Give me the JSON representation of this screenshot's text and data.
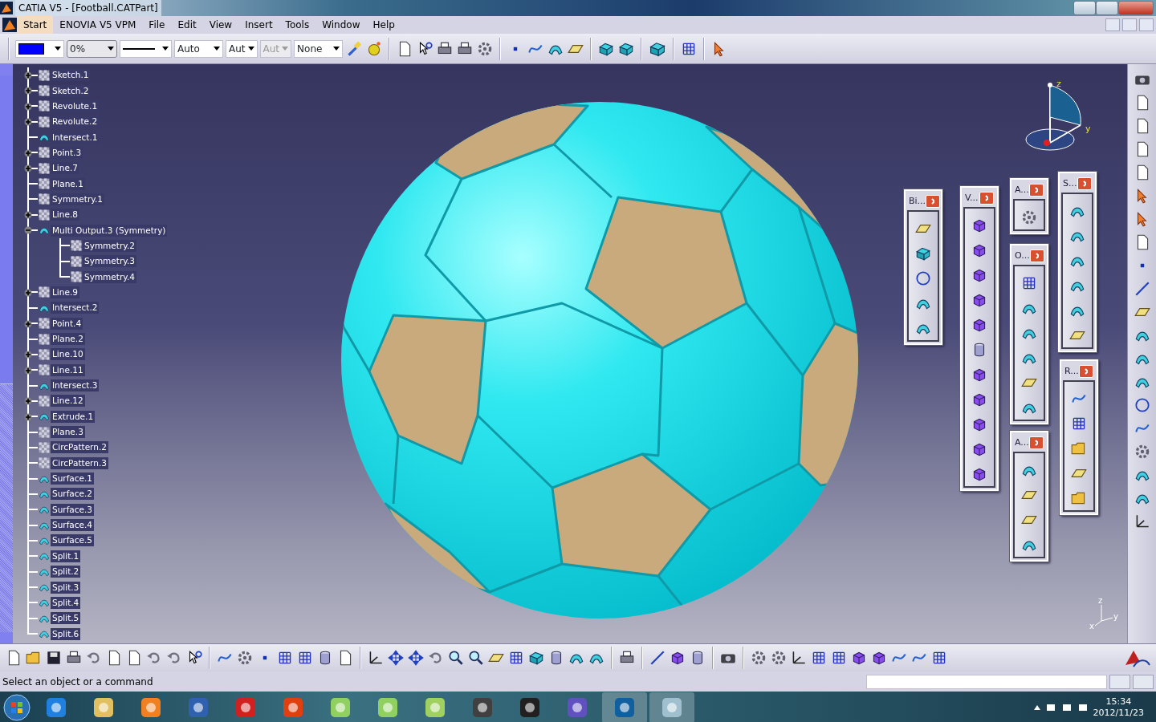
{
  "window": {
    "title": "CATIA V5 - [Football.CATPart]"
  },
  "menu": [
    {
      "label": "Start",
      "highlighted": true
    },
    {
      "label": "ENOVIA V5 VPM",
      "highlighted": false
    },
    {
      "label": "File",
      "highlighted": false
    },
    {
      "label": "Edit",
      "highlighted": false
    },
    {
      "label": "View",
      "highlighted": false
    },
    {
      "label": "Insert",
      "highlighted": false
    },
    {
      "label": "Tools",
      "highlighted": false
    },
    {
      "label": "Window",
      "highlighted": false
    },
    {
      "label": "Help",
      "highlighted": false
    }
  ],
  "format_toolbar": [
    {
      "kind": "color",
      "color": "#0000ff",
      "disabled": false
    },
    {
      "kind": "text",
      "value": "0%",
      "disabled": false
    },
    {
      "kind": "linetype",
      "disabled": false
    },
    {
      "kind": "text",
      "value": "Auto",
      "disabled": false
    },
    {
      "kind": "text",
      "value": "Aut",
      "disabled": false
    },
    {
      "kind": "text",
      "value": "Aut",
      "disabled": true
    },
    {
      "kind": "text",
      "value": "None",
      "disabled": false
    }
  ],
  "tree": [
    {
      "label": "Sketch.1",
      "kind": "sketch",
      "expandable": true,
      "expanded": false
    },
    {
      "label": "Sketch.2",
      "kind": "sketch",
      "expandable": true,
      "expanded": false
    },
    {
      "label": "Revolute.1",
      "kind": "revolute",
      "expandable": true,
      "expanded": false
    },
    {
      "label": "Revolute.2",
      "kind": "revolute",
      "expandable": true,
      "expanded": false
    },
    {
      "label": "Intersect.1",
      "kind": "intersect",
      "expandable": false,
      "expanded": false
    },
    {
      "label": "Point.3",
      "kind": "point",
      "expandable": true,
      "expanded": false
    },
    {
      "label": "Line.7",
      "kind": "line",
      "expandable": true,
      "expanded": false
    },
    {
      "label": "Plane.1",
      "kind": "plane",
      "expandable": false,
      "expanded": false
    },
    {
      "label": "Symmetry.1",
      "kind": "symmetry",
      "expandable": false,
      "expanded": false
    },
    {
      "label": "Line.8",
      "kind": "line",
      "expandable": true,
      "expanded": false
    },
    {
      "label": "Multi Output.3 (Symmetry)",
      "kind": "multi",
      "expandable": true,
      "expanded": true,
      "children": [
        {
          "label": "Symmetry.2",
          "kind": "symmetry",
          "expandable": false,
          "expanded": false
        },
        {
          "label": "Symmetry.3",
          "kind": "symmetry",
          "expandable": false,
          "expanded": false
        },
        {
          "label": "Symmetry.4",
          "kind": "symmetry",
          "expandable": false,
          "expanded": false
        }
      ]
    },
    {
      "label": "Line.9",
      "kind": "line",
      "expandable": true,
      "expanded": false
    },
    {
      "label": "Intersect.2",
      "kind": "intersect",
      "expandable": false,
      "expanded": false
    },
    {
      "label": "Point.4",
      "kind": "point",
      "expandable": true,
      "expanded": false
    },
    {
      "label": "Plane.2",
      "kind": "plane",
      "expandable": false,
      "expanded": false
    },
    {
      "label": "Line.10",
      "kind": "line",
      "expandable": true,
      "expanded": false
    },
    {
      "label": "Line.11",
      "kind": "line",
      "expandable": true,
      "expanded": false
    },
    {
      "label": "Intersect.3",
      "kind": "intersect",
      "expandable": false,
      "expanded": false
    },
    {
      "label": "Line.12",
      "kind": "line",
      "expandable": true,
      "expanded": false
    },
    {
      "label": "Extrude.1",
      "kind": "extrude",
      "expandable": true,
      "expanded": false
    },
    {
      "label": "Plane.3",
      "kind": "plane",
      "expandable": false,
      "expanded": false
    },
    {
      "label": "CircPattern.2",
      "kind": "pattern",
      "expandable": false,
      "expanded": false
    },
    {
      "label": "CircPattern.3",
      "kind": "pattern",
      "expandable": false,
      "expanded": false
    },
    {
      "label": "Surface.1",
      "kind": "surface",
      "expandable": false,
      "expanded": false
    },
    {
      "label": "Surface.2",
      "kind": "surface",
      "expandable": false,
      "expanded": false
    },
    {
      "label": "Surface.3",
      "kind": "surface",
      "expandable": false,
      "expanded": false
    },
    {
      "label": "Surface.4",
      "kind": "surface",
      "expandable": false,
      "expanded": false
    },
    {
      "label": "Surface.5",
      "kind": "surface",
      "expandable": false,
      "expanded": false
    },
    {
      "label": "Split.1",
      "kind": "split",
      "expandable": false,
      "expanded": false
    },
    {
      "label": "Split.2",
      "kind": "split",
      "expandable": false,
      "expanded": false
    },
    {
      "label": "Split.3",
      "kind": "split",
      "expandable": false,
      "expanded": false
    },
    {
      "label": "Split.4",
      "kind": "split",
      "expandable": false,
      "expanded": false
    },
    {
      "label": "Split.5",
      "kind": "split",
      "expandable": false,
      "expanded": false
    },
    {
      "label": "Split.6",
      "kind": "split",
      "expandable": false,
      "expanded": false
    }
  ],
  "compass": {
    "labels": [
      "z",
      "y"
    ]
  },
  "axes": {
    "labels": [
      "z",
      "y",
      "x"
    ]
  },
  "palettes": [
    {
      "title": "Bi..."
    },
    {
      "title": "V..."
    },
    {
      "title": "A..."
    },
    {
      "title": "O..."
    },
    {
      "title": "A..."
    },
    {
      "title": "S..."
    },
    {
      "title": "R..."
    }
  ],
  "status_bar": {
    "message": "Select an object or a command"
  },
  "taskbar": {
    "apps": [
      {
        "highlighted": false
      },
      {
        "highlighted": false
      },
      {
        "highlighted": false
      },
      {
        "highlighted": false
      },
      {
        "highlighted": false
      },
      {
        "highlighted": false
      },
      {
        "highlighted": false
      },
      {
        "highlighted": false
      },
      {
        "highlighted": false
      },
      {
        "highlighted": false
      },
      {
        "highlighted": false
      },
      {
        "highlighted": false
      },
      {
        "highlighted": true
      },
      {
        "highlighted": true
      }
    ],
    "time": "15:34",
    "date": "2012/11/23"
  }
}
